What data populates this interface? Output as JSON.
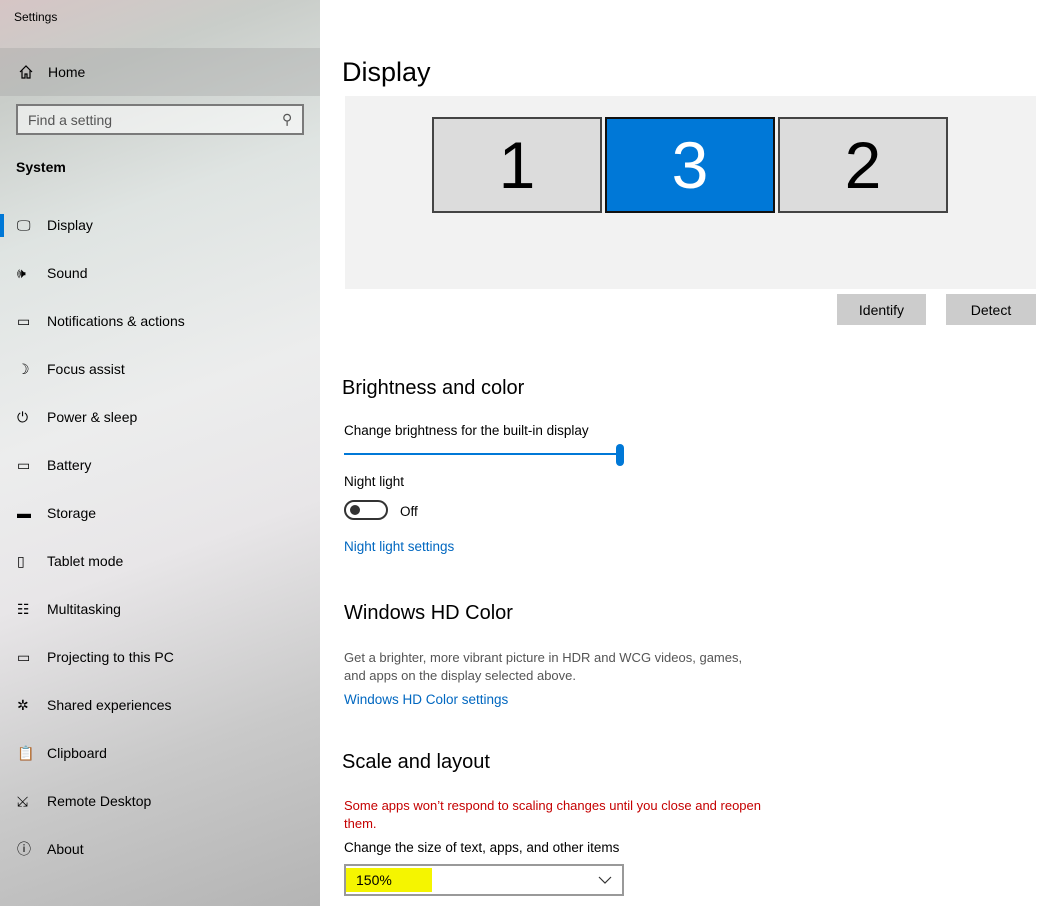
{
  "window": {
    "title": "Settings"
  },
  "sidebar": {
    "home": "Home",
    "search_placeholder": "Find a setting",
    "section": "System",
    "items": [
      {
        "label": "Display",
        "icon": "monitor-icon"
      },
      {
        "label": "Sound",
        "icon": "speaker-icon"
      },
      {
        "label": "Notifications & actions",
        "icon": "notification-icon"
      },
      {
        "label": "Focus assist",
        "icon": "moon-icon"
      },
      {
        "label": "Power & sleep",
        "icon": "power-icon"
      },
      {
        "label": "Battery",
        "icon": "battery-icon"
      },
      {
        "label": "Storage",
        "icon": "storage-icon"
      },
      {
        "label": "Tablet mode",
        "icon": "tablet-icon"
      },
      {
        "label": "Multitasking",
        "icon": "multitasking-icon"
      },
      {
        "label": "Projecting to this PC",
        "icon": "projecting-icon"
      },
      {
        "label": "Shared experiences",
        "icon": "share-icon"
      },
      {
        "label": "Clipboard",
        "icon": "clipboard-icon"
      },
      {
        "label": "Remote Desktop",
        "icon": "remote-icon"
      },
      {
        "label": "About",
        "icon": "info-icon"
      }
    ]
  },
  "main": {
    "title": "Display",
    "monitors": [
      "1",
      "3",
      "2"
    ],
    "selected_monitor": "3",
    "identify": "Identify",
    "detect": "Detect",
    "brightness": {
      "heading": "Brightness and color",
      "label": "Change brightness for the built-in display",
      "value_percent": 100
    },
    "night_light": {
      "label": "Night light",
      "state": "Off",
      "link": "Night light settings"
    },
    "hd": {
      "heading": "Windows HD Color",
      "desc_line1": "Get a brighter, more vibrant picture in HDR and WCG videos, games,",
      "desc_line2": "and apps on the display selected above.",
      "link": "Windows HD Color settings"
    },
    "scale": {
      "heading": "Scale and layout",
      "warning_line1": "Some apps won’t respond to scaling changes until you close and reopen",
      "warning_line2": "them.",
      "label": "Change the size of text, apps, and other items",
      "value": "150%"
    }
  },
  "colors": {
    "accent": "#0078d7",
    "warning": "#c50000",
    "highlight": "#f5f500"
  }
}
